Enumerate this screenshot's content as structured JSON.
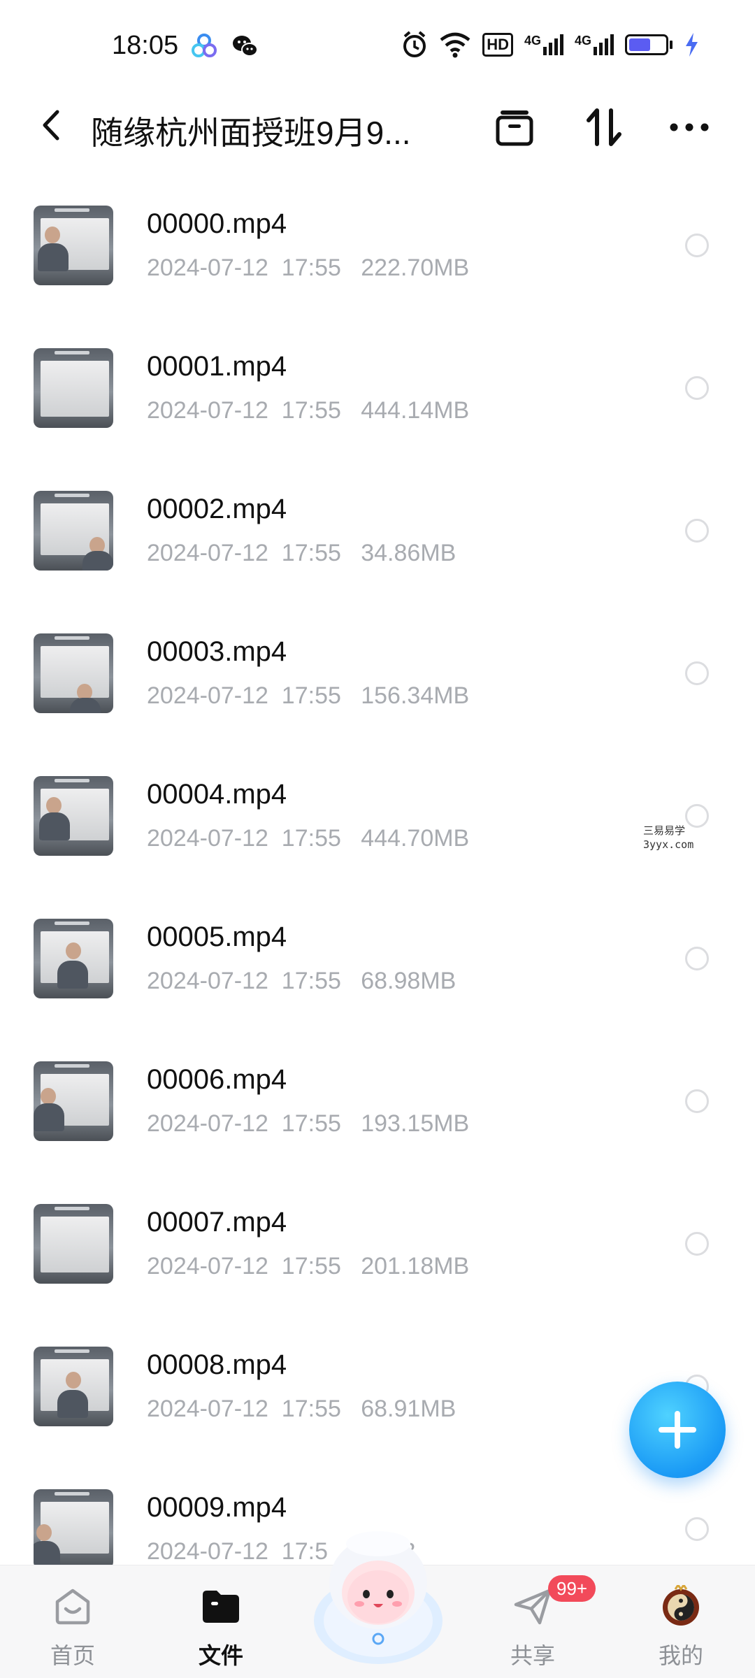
{
  "status_bar": {
    "time": "18:05",
    "hd_label": "HD",
    "network_left": "4G",
    "network_right": "4G"
  },
  "header": {
    "title": "随缘杭州面授班9月9..."
  },
  "files": [
    {
      "name": "00000.mp4",
      "meta": "2024-07-12  17:55   222.70MB"
    },
    {
      "name": "00001.mp4",
      "meta": "2024-07-12  17:55   444.14MB"
    },
    {
      "name": "00002.mp4",
      "meta": "2024-07-12  17:55   34.86MB"
    },
    {
      "name": "00003.mp4",
      "meta": "2024-07-12  17:55   156.34MB"
    },
    {
      "name": "00004.mp4",
      "meta": "2024-07-12  17:55   444.70MB"
    },
    {
      "name": "00005.mp4",
      "meta": "2024-07-12  17:55   68.98MB"
    },
    {
      "name": "00006.mp4",
      "meta": "2024-07-12  17:55   193.15MB"
    },
    {
      "name": "00007.mp4",
      "meta": "2024-07-12  17:55   201.18MB"
    },
    {
      "name": "00008.mp4",
      "meta": "2024-07-12  17:55   68.91MB"
    },
    {
      "name": "00009.mp4",
      "meta": "2024-07-12  17:5   .65MB"
    }
  ],
  "watermark": {
    "line1": "三易易学",
    "line2": "3yyx.com"
  },
  "bottom_nav": {
    "home": "首页",
    "files": "文件",
    "share": "共享",
    "share_badge": "99+",
    "mine": "我的"
  },
  "colors": {
    "accent": "#1a9af5",
    "badge": "#f24a5a",
    "meta_text": "#a8abb0"
  },
  "icons": {
    "back": "chevron-left-icon",
    "archive": "archive-icon",
    "sort": "sort-icon",
    "more": "more-icon",
    "add": "plus-icon"
  }
}
